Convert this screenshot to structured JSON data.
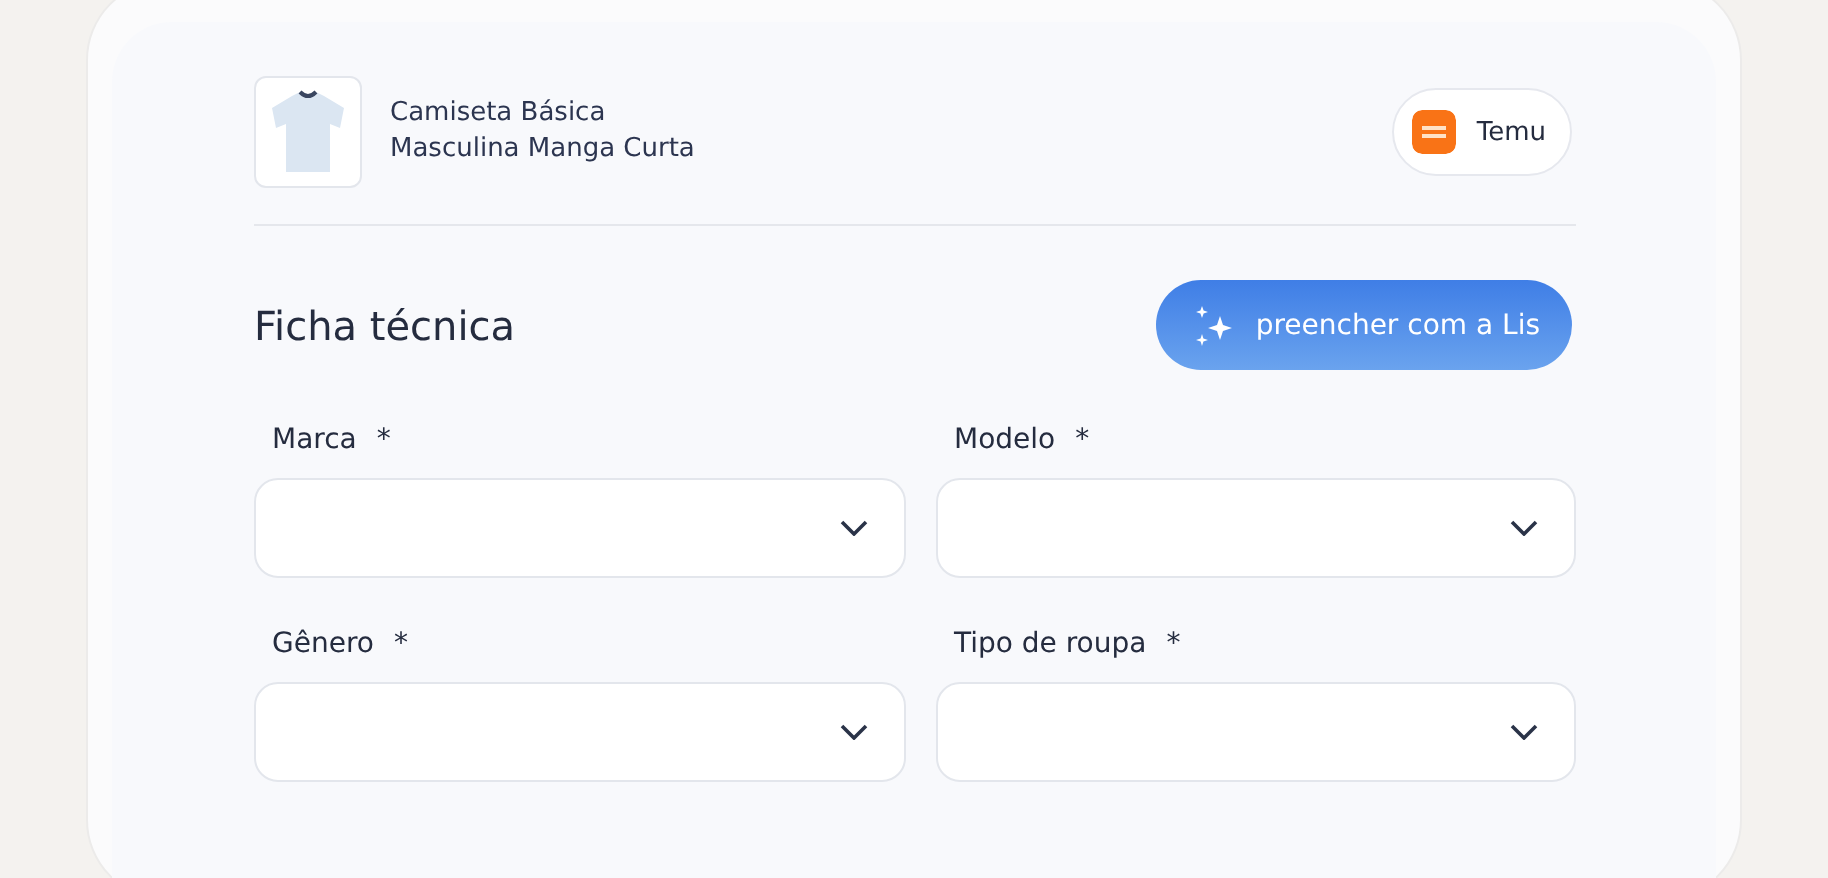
{
  "product": {
    "name_line_1": "Camiseta Básica",
    "name_line_2": "Masculina Manga Curta",
    "store": "Temu"
  },
  "section": {
    "title": "Ficha técnica",
    "fill_button": "preencher com a Lis"
  },
  "fields": [
    {
      "label": "Marca",
      "required_mark": "*"
    },
    {
      "label": "Modelo",
      "required_mark": "*"
    },
    {
      "label": "Gênero",
      "required_mark": "*"
    },
    {
      "label": "Tipo de roupa",
      "required_mark": "*"
    }
  ]
}
